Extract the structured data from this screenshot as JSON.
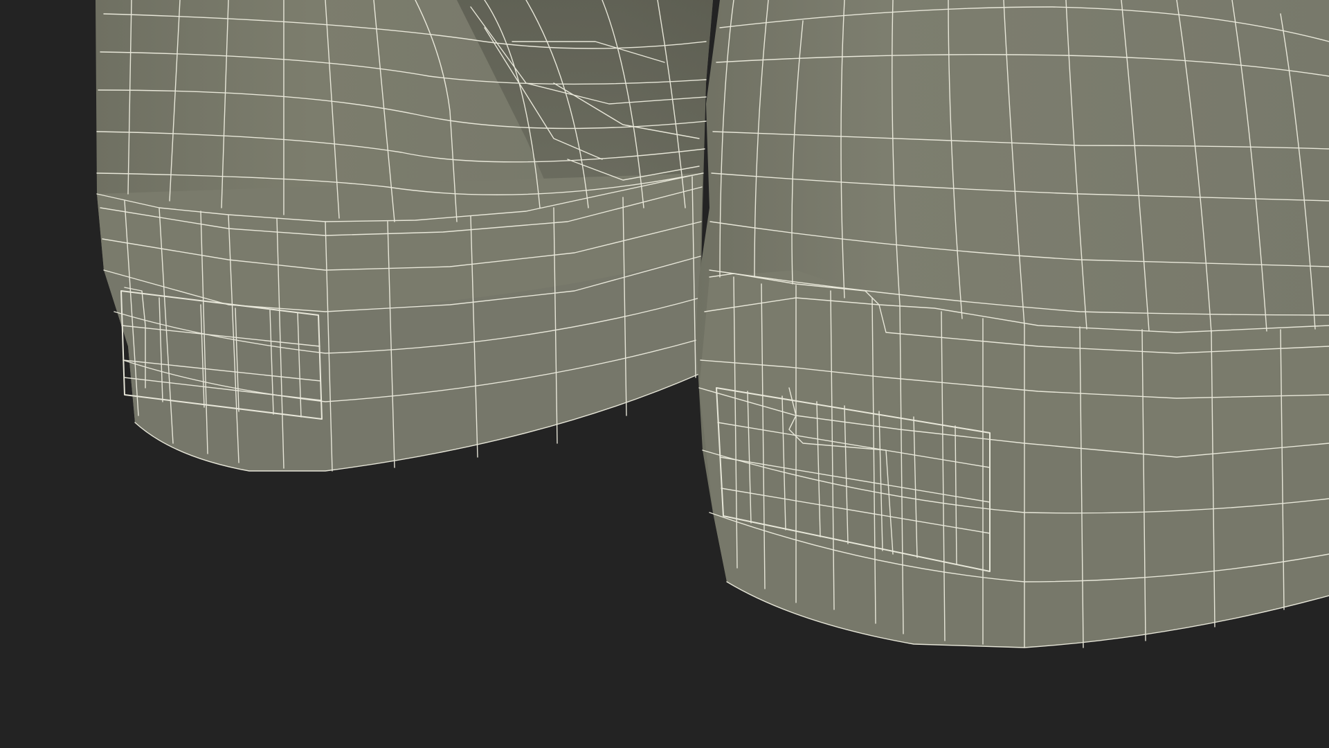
{
  "scene": {
    "description_visible_text": "",
    "colors": {
      "background": "#232323",
      "mesh_fill": "#7b7c6c",
      "mesh_fill_dark": "#6d6e60",
      "mesh_shadow": "#5f6053",
      "mesh_highlight": "#85867a",
      "wireframe": "#efeee0"
    },
    "objects": [
      {
        "name": "left-shorts-leg-mesh"
      },
      {
        "name": "right-shorts-leg-mesh"
      }
    ]
  }
}
